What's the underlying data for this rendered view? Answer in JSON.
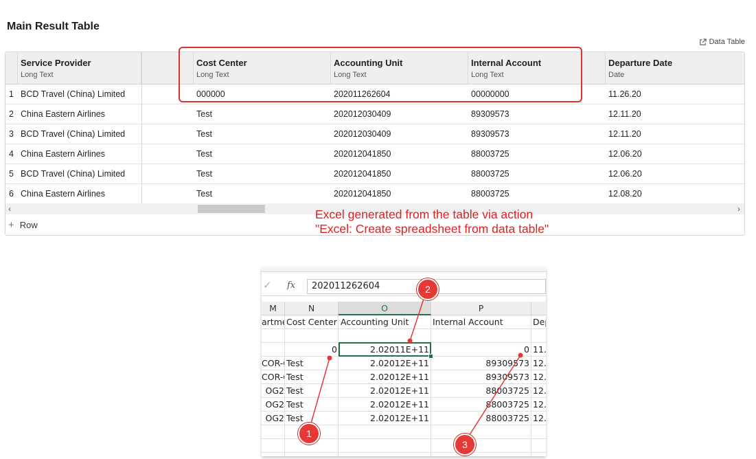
{
  "title": "Main Result Table",
  "data_table_link": "Data Table",
  "columns": [
    {
      "name": "Service Provider",
      "type": "Long Text"
    },
    {
      "name": "Cost Center",
      "type": "Long Text"
    },
    {
      "name": "Accounting Unit",
      "type": "Long Text"
    },
    {
      "name": "Internal Account",
      "type": "Long Text"
    },
    {
      "name": "Departure Date",
      "type": "Date"
    }
  ],
  "rows": [
    {
      "num": "1",
      "provider": "BCD Travel (China) Limited",
      "cost_center": "000000",
      "accounting_unit": "202011262604",
      "internal_account": "00000000",
      "departure": "11.26.20"
    },
    {
      "num": "2",
      "provider": "China Eastern Airlines",
      "cost_center": "Test",
      "accounting_unit": "202012030409",
      "internal_account": "89309573",
      "departure": "12.11.20"
    },
    {
      "num": "3",
      "provider": "BCD Travel (China) Limited",
      "cost_center": "Test",
      "accounting_unit": "202012030409",
      "internal_account": "89309573",
      "departure": "12.11.20"
    },
    {
      "num": "4",
      "provider": "China Eastern Airlines",
      "cost_center": "Test",
      "accounting_unit": "202012041850",
      "internal_account": "88003725",
      "departure": "12.06.20"
    },
    {
      "num": "5",
      "provider": "BCD Travel (China) Limited",
      "cost_center": "Test",
      "accounting_unit": "202012041850",
      "internal_account": "88003725",
      "departure": "12.06.20"
    },
    {
      "num": "6",
      "provider": "China Eastern Airlines",
      "cost_center": "Test",
      "accounting_unit": "202012041850",
      "internal_account": "88003725",
      "departure": "12.08.20"
    }
  ],
  "add_row_label": "Row",
  "annotation": {
    "line1": "Excel generated from the table via action",
    "line2": "\"Excel: Create spreadsheet from data table\""
  },
  "excel": {
    "formula_value": "202011262604",
    "fx": "fx",
    "col_letters": [
      "M",
      "N",
      "O",
      "P",
      ""
    ],
    "header_row": [
      "artme",
      "Cost Center",
      "Accounting Unit",
      "Internal Account",
      "Dep"
    ],
    "rows": [
      [
        "",
        "",
        "",
        "",
        ""
      ],
      [
        "",
        "0",
        "2.02011E+11",
        "0",
        "11."
      ],
      [
        "COR-C",
        "Test",
        "2.02012E+11",
        "89309573",
        "12."
      ],
      [
        "COR-C",
        "Test",
        "2.02012E+11",
        "89309573",
        "12."
      ],
      [
        "OG2",
        "Test",
        "2.02012E+11",
        "88003725",
        "12."
      ],
      [
        "OG2",
        "Test",
        "2.02012E+11",
        "88003725",
        "12."
      ],
      [
        "OG2",
        "Test",
        "2.02012E+11",
        "88003725",
        "12."
      ]
    ]
  },
  "callouts": [
    "1",
    "2",
    "3"
  ],
  "colors": {
    "highlight": "#e03030",
    "excel_green": "#217346",
    "badge": "#e53935"
  }
}
